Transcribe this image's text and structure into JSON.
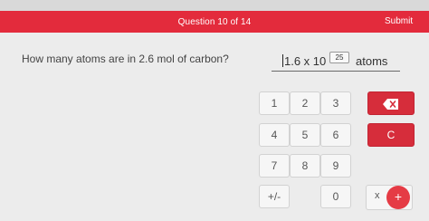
{
  "header": {
    "question_progress": "Question 10 of 14",
    "submit_label": "Submit"
  },
  "question": {
    "text": "How many atoms are in 2.6 mol of carbon?"
  },
  "answer": {
    "mantissa": "1.6 x 10",
    "exponent": "25",
    "unit": "atoms"
  },
  "keypad": {
    "keys": [
      "1",
      "2",
      "3",
      "4",
      "5",
      "6",
      "7",
      "8",
      "9",
      "+/-",
      "0"
    ],
    "clear_label": "C",
    "times_label": "x",
    "plus_label": "+"
  },
  "colors": {
    "header": "#e32b3c",
    "button_red": "#d62d3b",
    "panel": "#ececec"
  },
  "icons": {
    "backspace": "backspace-icon"
  }
}
